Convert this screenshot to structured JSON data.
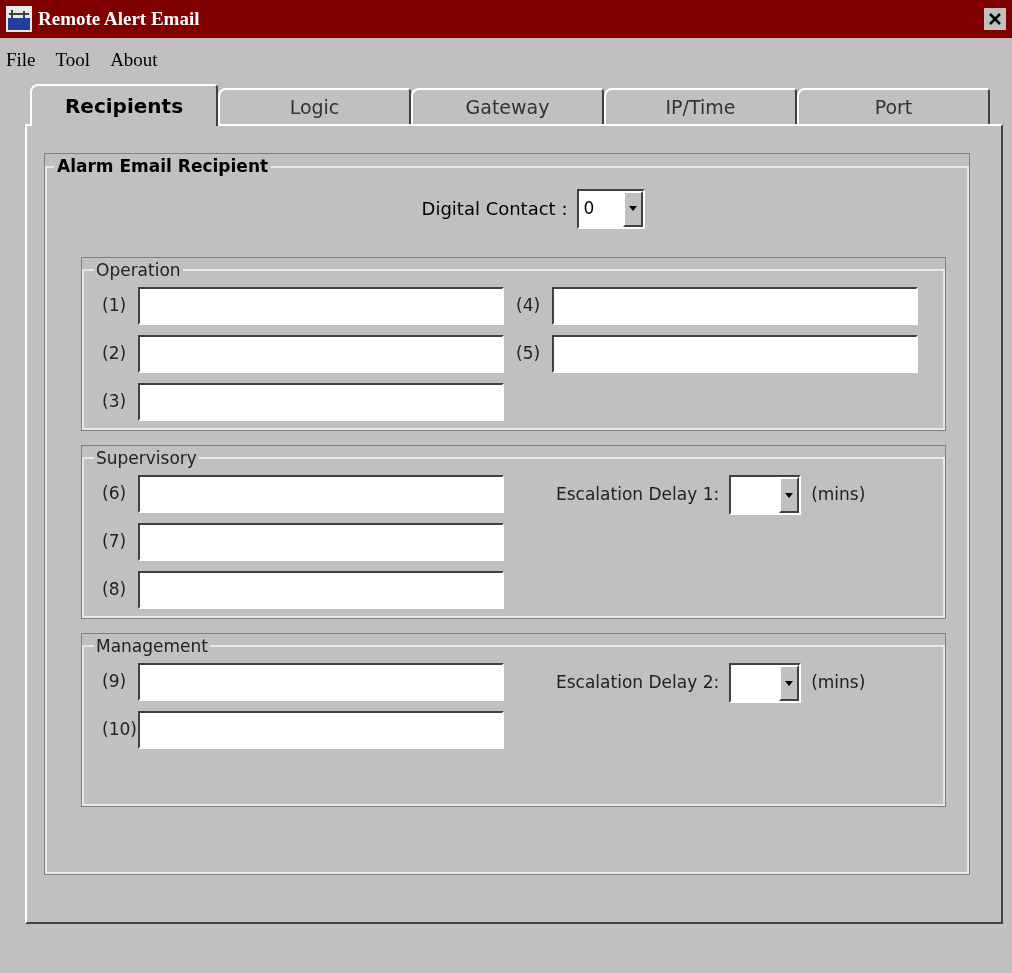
{
  "window": {
    "title": "Remote Alert Email"
  },
  "menu": [
    "File",
    "Tool",
    "About"
  ],
  "tabs": [
    {
      "label": "Recipients",
      "selected": true
    },
    {
      "label": "Logic",
      "selected": false
    },
    {
      "label": "Gateway",
      "selected": false
    },
    {
      "label": "IP/Time",
      "selected": false
    },
    {
      "label": "Port",
      "selected": false
    }
  ],
  "group": {
    "title": "Alarm Email Recipient",
    "digital_contact": {
      "label": "Digital Contact :",
      "value": "0"
    },
    "sections": [
      {
        "title": "Operation",
        "left": [
          {
            "label": "(1)"
          },
          {
            "label": "(2)"
          },
          {
            "label": "(3)"
          }
        ],
        "right": [
          {
            "kind": "field",
            "label": "(4)"
          },
          {
            "kind": "field",
            "label": "(5)"
          }
        ]
      },
      {
        "title": "Supervisory",
        "left": [
          {
            "label": "(6)"
          },
          {
            "label": "(7)"
          },
          {
            "label": "(8)"
          }
        ],
        "right": [
          {
            "kind": "escalation",
            "label": "Escalation Delay 1:",
            "unit": "(mins)"
          }
        ]
      },
      {
        "title": "Management",
        "left": [
          {
            "label": "(9)"
          },
          {
            "label": "(10)"
          }
        ],
        "right": [
          {
            "kind": "escalation",
            "label": "Escalation Delay 2:",
            "unit": "(mins)"
          }
        ]
      }
    ]
  }
}
